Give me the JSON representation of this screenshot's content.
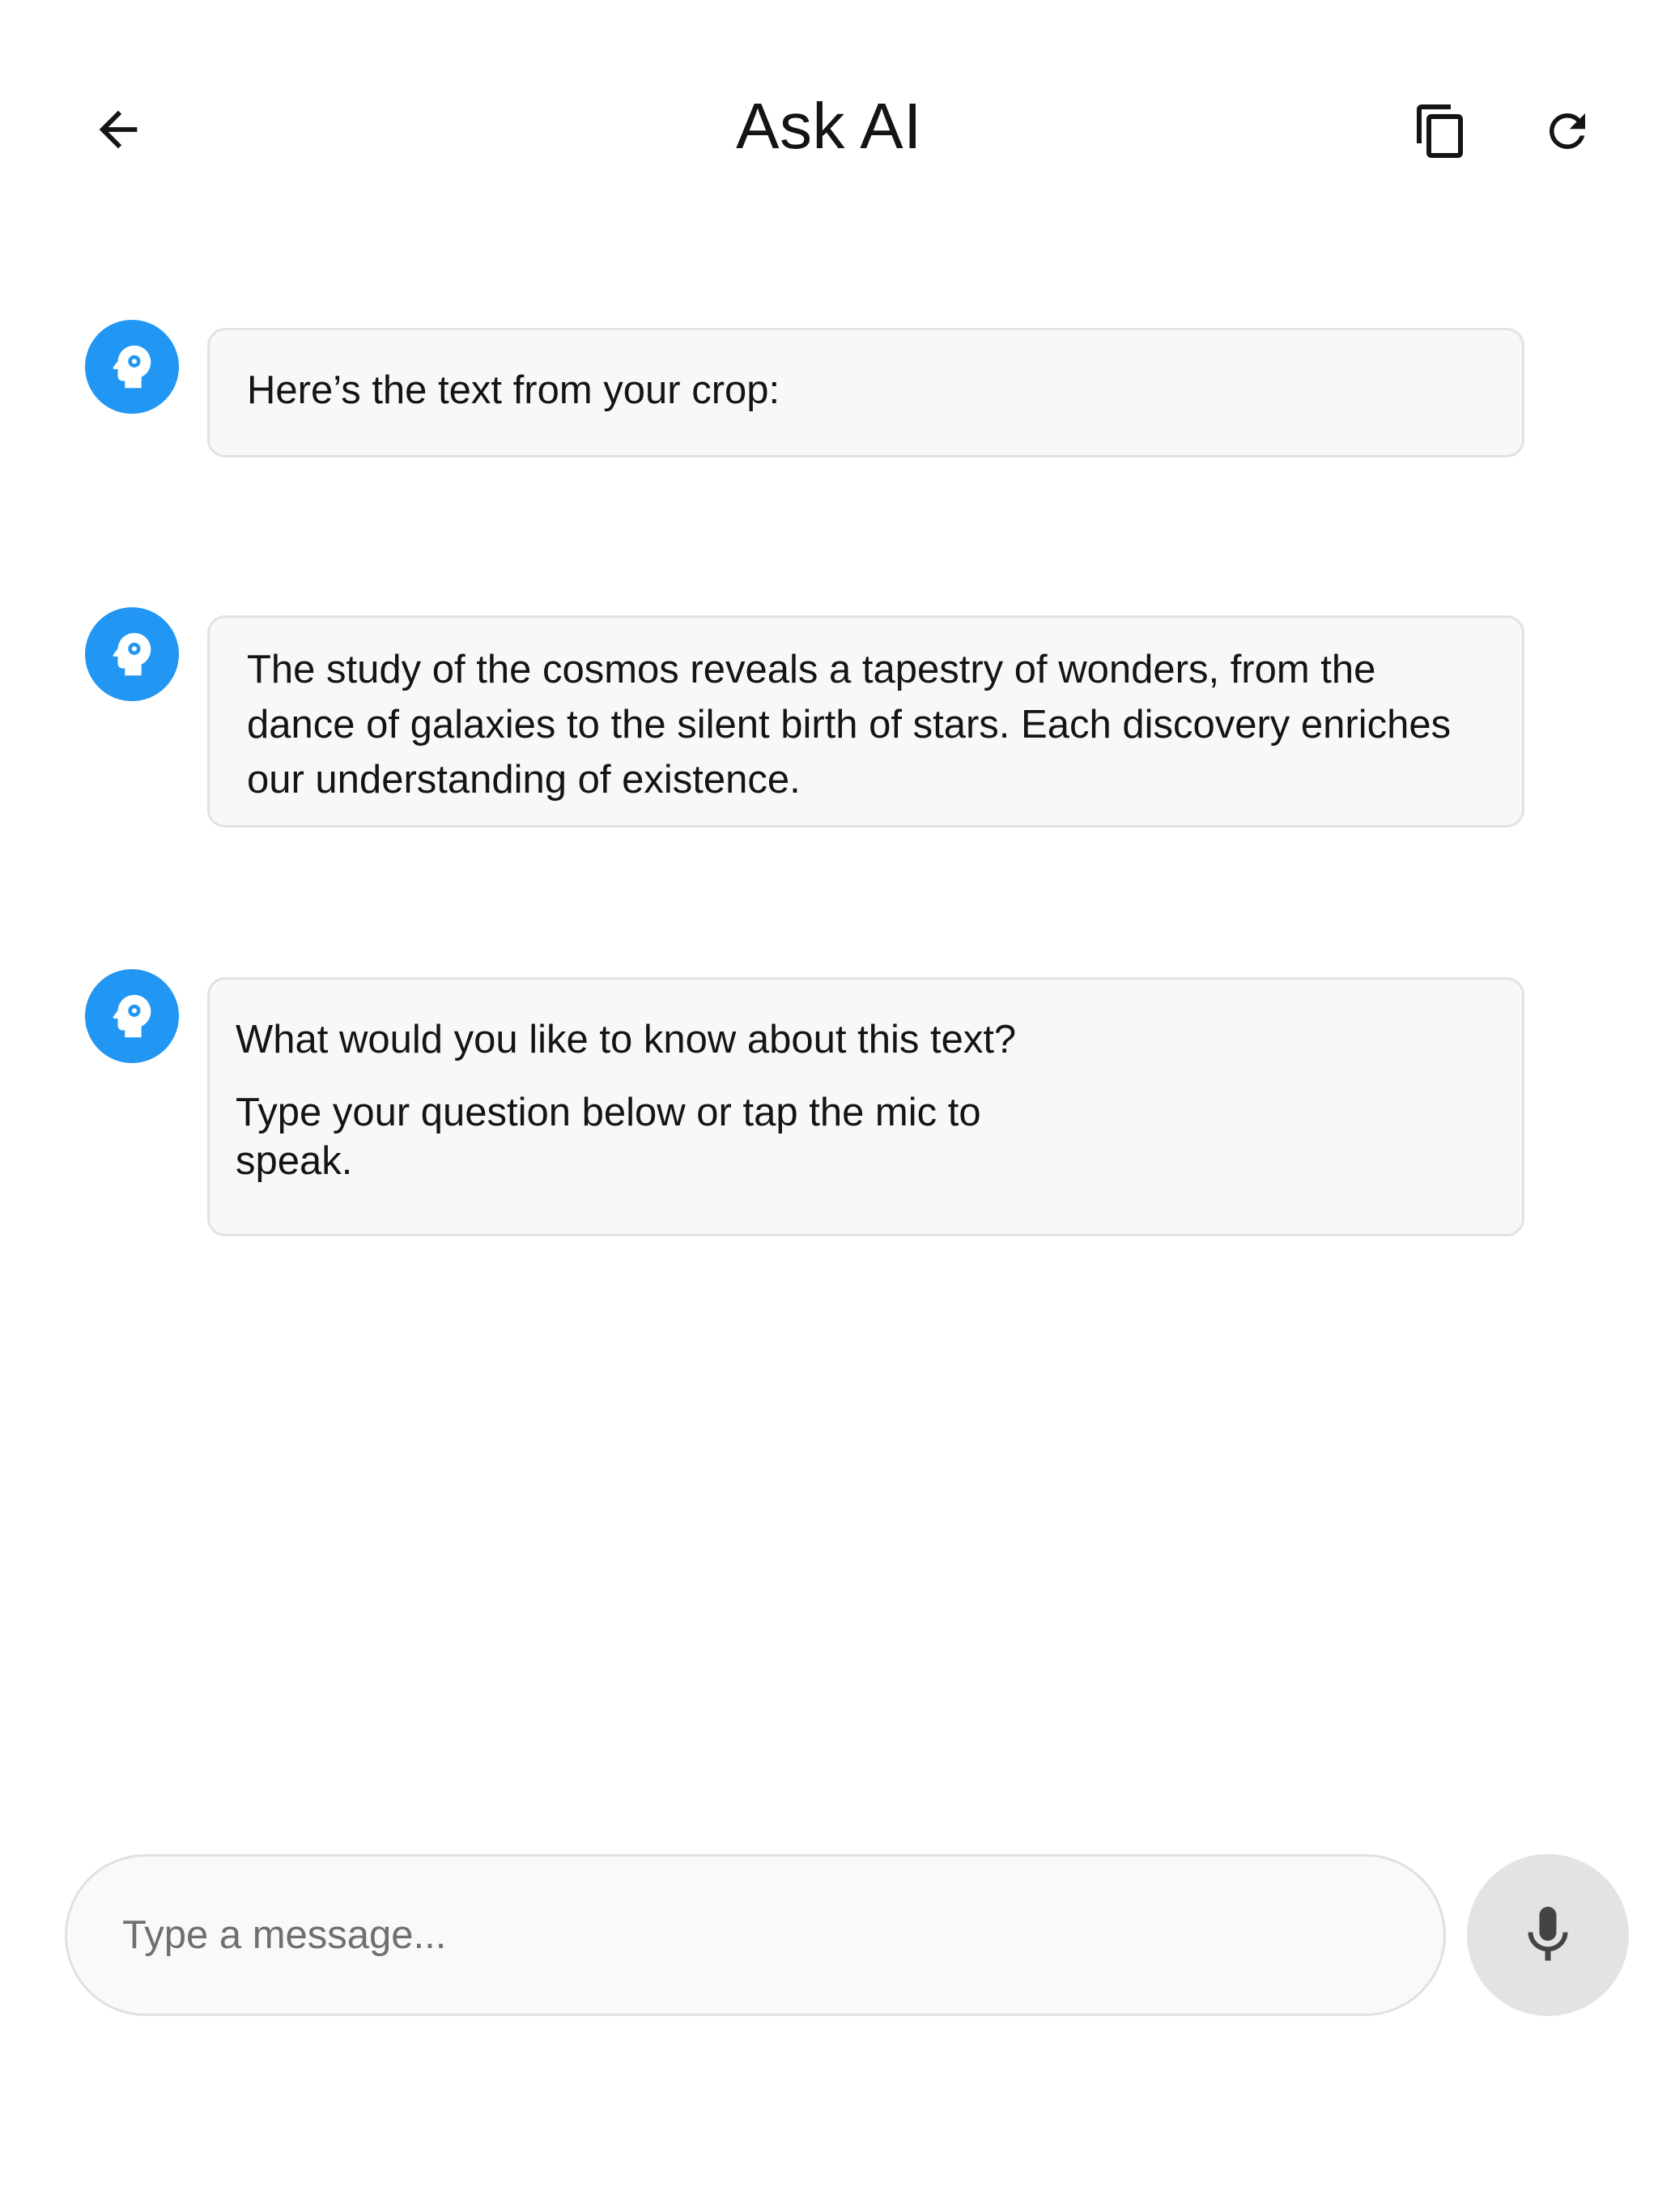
{
  "header": {
    "title": "Ask AI",
    "back_icon": "arrow-left-icon",
    "copy_icon": "copy-icon",
    "refresh_icon": "refresh-icon"
  },
  "messages": [
    {
      "sender": "ai",
      "avatar_icon": "ai-head-gear-icon",
      "text": "Here’s the text from your crop:"
    },
    {
      "sender": "ai",
      "avatar_icon": "ai-head-gear-icon",
      "text": "The study of the cosmos reveals a tapestry of wonders, from the dance of galaxies to the silent birth of stars. Each discovery enriches our understanding of existence."
    },
    {
      "sender": "ai",
      "avatar_icon": "ai-head-gear-icon",
      "line1": "What would you like to know about this text?",
      "line2": "Type your question below or tap the mic to speak."
    }
  ],
  "composer": {
    "placeholder": "Type a message...",
    "value": "",
    "mic_icon": "microphone-icon"
  },
  "colors": {
    "accent": "#2196F3",
    "bubble_bg": "#F8F8F8",
    "bubble_border": "#E2E2E2",
    "mic_bg": "#E3E3E3",
    "text": "#141414",
    "placeholder": "#6F6F6F"
  }
}
